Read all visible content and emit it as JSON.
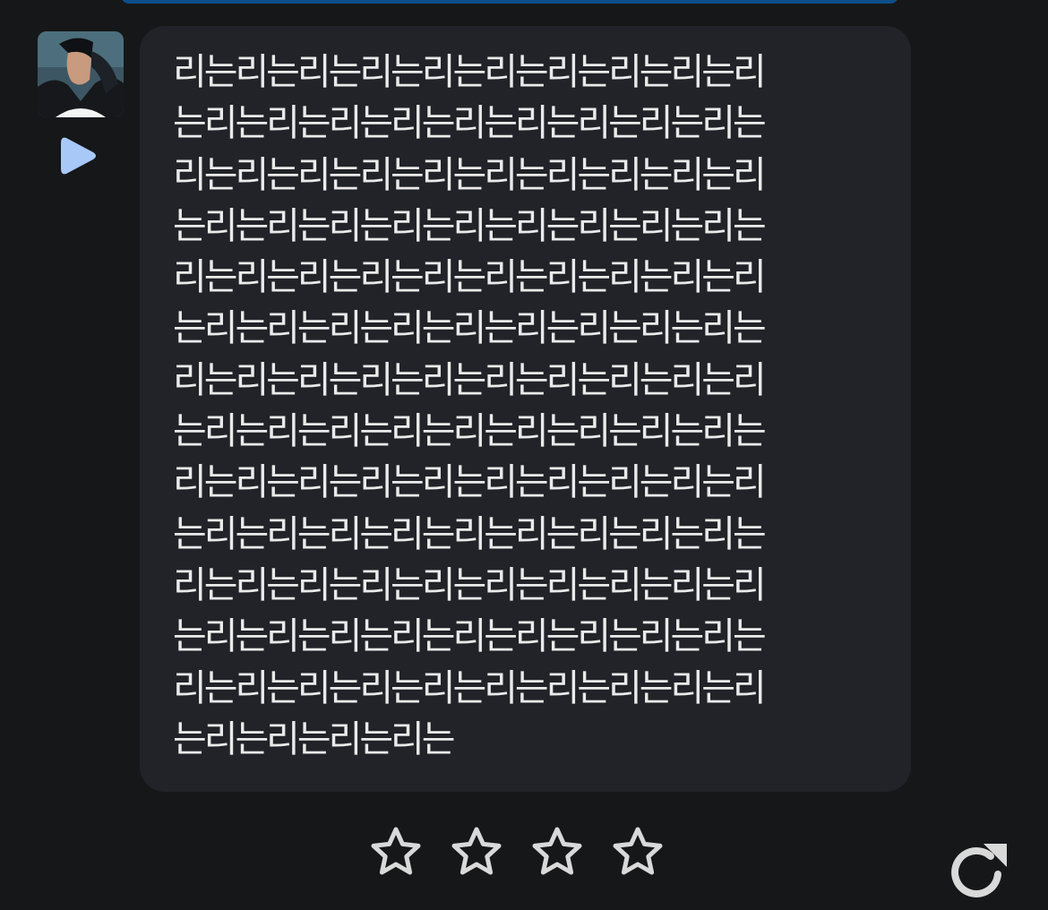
{
  "message": {
    "lines": [
      "리는리는리는리는리는리는리는리는리는리",
      "는리는리는리는리는리는리는리는리는리는",
      "리는리는리는리는리는리는리는리는리는리",
      "는리는리는리는리는리는리는리는리는리는",
      "리는리는리는리는리는리는리는리는리는리",
      "는리는리는리는리는리는리는리는리는리는",
      "리는리는리는리는리는리는리는리는리는리",
      "는리는리는리는리는리는리는리는리는리는",
      "리는리는리는리는리는리는리는리는리는리",
      "는리는리는리는리는리는리는리는리는리는",
      "리는리는리는리는리는리는리는리는리는리",
      "는리는리는리는리는리는리는리는리는리는",
      "리는리는리는리는리는리는리는리는리는리",
      "는리는리는리는리는"
    ]
  },
  "rating": {
    "max_stars": 4,
    "selected": 0
  },
  "icons": {
    "play": "play-icon",
    "star": "star-outline-icon",
    "regenerate": "regenerate-icon"
  },
  "colors": {
    "background": "#161719",
    "bubble": "#212328",
    "text": "#eaeaea",
    "accent": "#a8c8f8",
    "top_bar": "#0e4f8a",
    "icon_outline": "#d9d9d9"
  }
}
